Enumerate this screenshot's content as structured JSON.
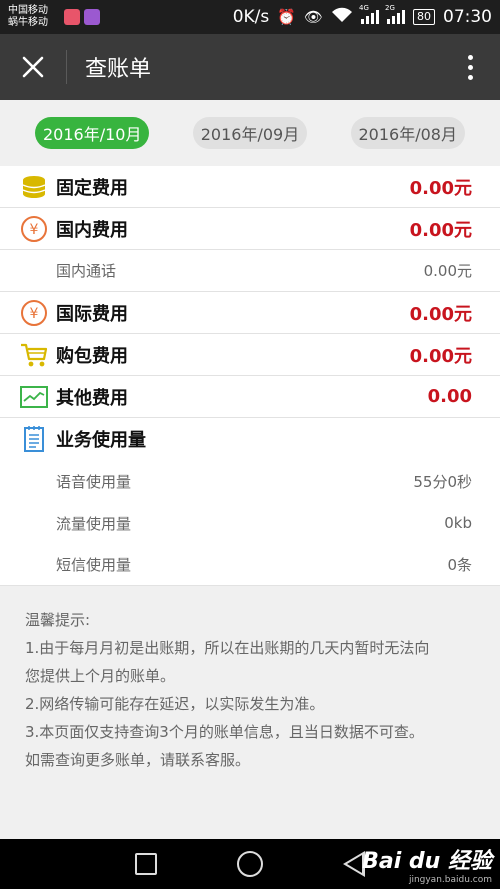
{
  "status_bar": {
    "carrier_1": "中国移动",
    "carrier_2": "蜗牛移动",
    "speed": "0K/s",
    "network_1": "4G",
    "network_2": "2G",
    "battery": "80",
    "time": "07:30"
  },
  "header": {
    "title": "查账单"
  },
  "tabs": [
    {
      "label": "2016年/10月",
      "active": true
    },
    {
      "label": "2016年/09月",
      "active": false
    },
    {
      "label": "2016年/08月",
      "active": false
    }
  ],
  "bill": {
    "fixed": {
      "label": "固定费用",
      "amount": "0.00元",
      "icon": "coins-icon"
    },
    "domestic": {
      "label": "国内费用",
      "amount": "0.00元",
      "icon": "yen-icon"
    },
    "domestic_call": {
      "label": "国内通话",
      "amount": "0.00元"
    },
    "international": {
      "label": "国际费用",
      "amount": "0.00元",
      "icon": "yen-icon"
    },
    "package": {
      "label": "购包费用",
      "amount": "0.00元",
      "icon": "cart-icon"
    },
    "other": {
      "label": "其他费用",
      "amount": "0.00",
      "icon": "chart-icon"
    },
    "usage": {
      "label": "业务使用量",
      "icon": "document-icon"
    },
    "voice": {
      "label": "语音使用量",
      "value": "55分0秒"
    },
    "data_usage": {
      "label": "流量使用量",
      "value": "0kb"
    },
    "sms": {
      "label": "短信使用量",
      "value": "0条"
    }
  },
  "tips": {
    "title": "温馨提示:",
    "line1a": "1.由于每月月初是出账期，所以在出账期的几天内暂时无法向",
    "line1b": "您提供上个月的账单。",
    "line2": "2.网络传输可能存在延迟，以实际发生为准。",
    "line3a": "3.本页面仅支持查询3个月的账单信息，且当日数据不可查。",
    "line3b": "如需查询更多账单，请联系客服。"
  },
  "watermark": {
    "brand": "Bai du 经验",
    "url": "jingyan.baidu.com"
  },
  "colors": {
    "accent_green": "#38b43f",
    "amount_red": "#c8141e",
    "icon_yellow": "#d8b800",
    "icon_orange": "#e8743a",
    "icon_green": "#3cb44a",
    "icon_blue": "#3a8fd8"
  }
}
